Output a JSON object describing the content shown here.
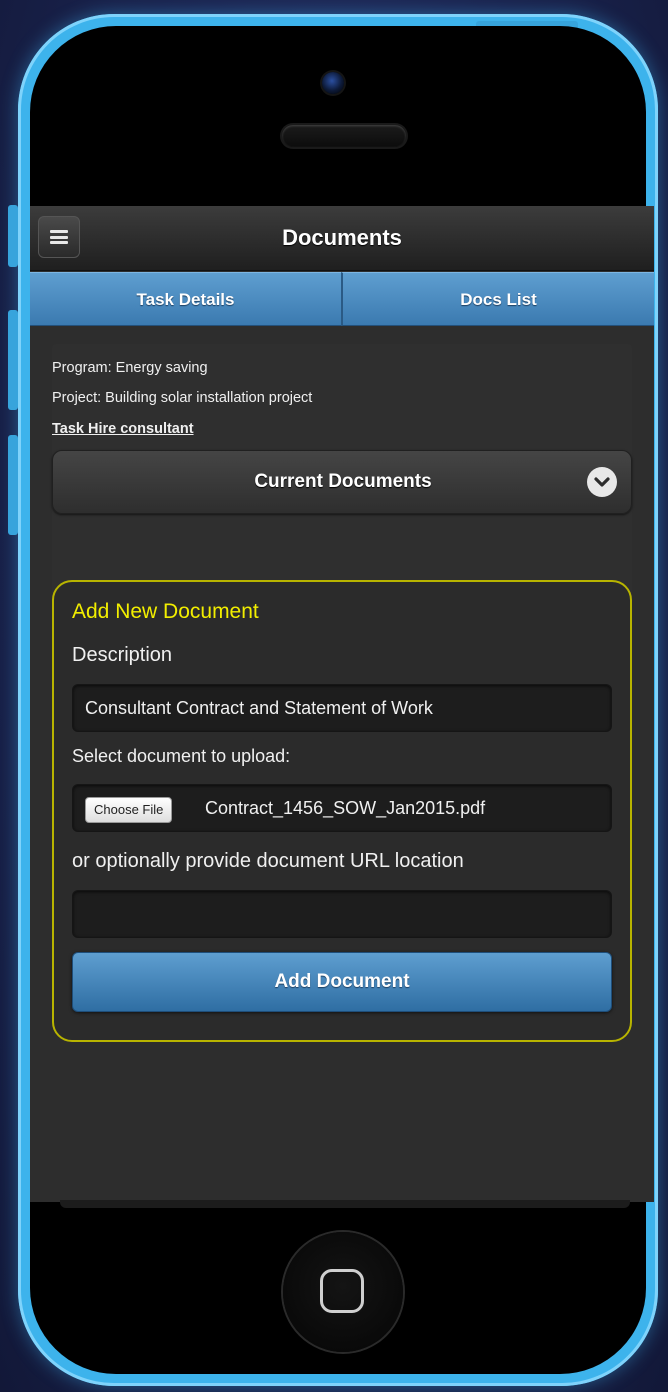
{
  "header": {
    "title": "Documents"
  },
  "tabs": [
    {
      "label": "Task Details"
    },
    {
      "label": "Docs List"
    }
  ],
  "info": {
    "program": "Program: Energy saving",
    "project": "Project: Building solar installation project",
    "task": "Task Hire consultant"
  },
  "current_documents": {
    "label": "Current Documents"
  },
  "form": {
    "heading": "Add New Document",
    "description_label": "Description",
    "description_value": "Consultant Contract and Statement of Work",
    "upload_label": "Select document to upload:",
    "choose_file_label": "Choose File",
    "file_name": "Contract_1456_SOW_Jan2015.pdf",
    "url_label": "or optionally provide document URL location",
    "url_value": "",
    "submit_label": "Add Document"
  },
  "colors": {
    "accent_blue": "#4a8cc2",
    "form_border": "#b8b400",
    "form_heading": "#f2ee00",
    "phone_frame": "#3db3ec"
  }
}
